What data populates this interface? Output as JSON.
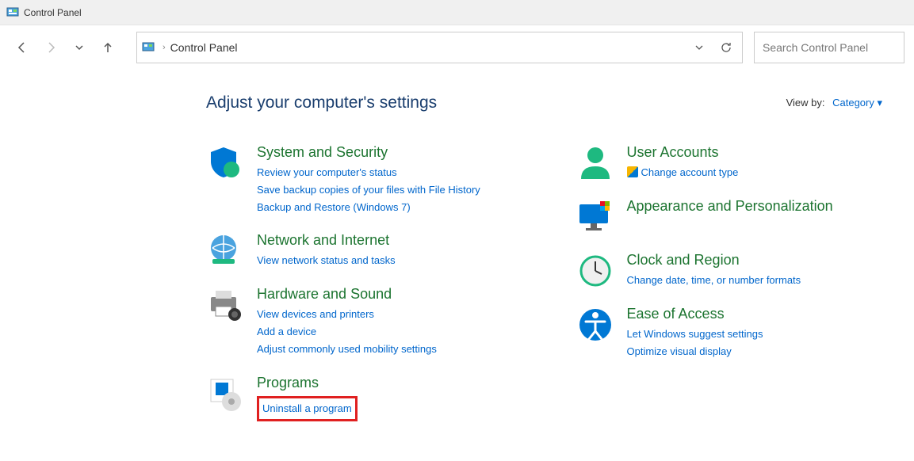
{
  "titlebar": {
    "title": "Control Panel"
  },
  "breadcrumb": {
    "path": "Control Panel"
  },
  "search": {
    "placeholder": "Search Control Panel"
  },
  "heading": "Adjust your computer's settings",
  "viewby": {
    "label": "View by:",
    "value": "Category"
  },
  "categories": {
    "system_security": {
      "title": "System and Security",
      "links": [
        "Review your computer's status",
        "Save backup copies of your files with File History",
        "Backup and Restore (Windows 7)"
      ]
    },
    "network": {
      "title": "Network and Internet",
      "links": [
        "View network status and tasks"
      ]
    },
    "hardware": {
      "title": "Hardware and Sound",
      "links": [
        "View devices and printers",
        "Add a device",
        "Adjust commonly used mobility settings"
      ]
    },
    "programs": {
      "title": "Programs",
      "links": [
        "Uninstall a program"
      ]
    },
    "user_accounts": {
      "title": "User Accounts",
      "links": [
        "Change account type"
      ]
    },
    "appearance": {
      "title": "Appearance and Personalization",
      "links": []
    },
    "clock": {
      "title": "Clock and Region",
      "links": [
        "Change date, time, or number formats"
      ]
    },
    "ease": {
      "title": "Ease of Access",
      "links": [
        "Let Windows suggest settings",
        "Optimize visual display"
      ]
    }
  }
}
